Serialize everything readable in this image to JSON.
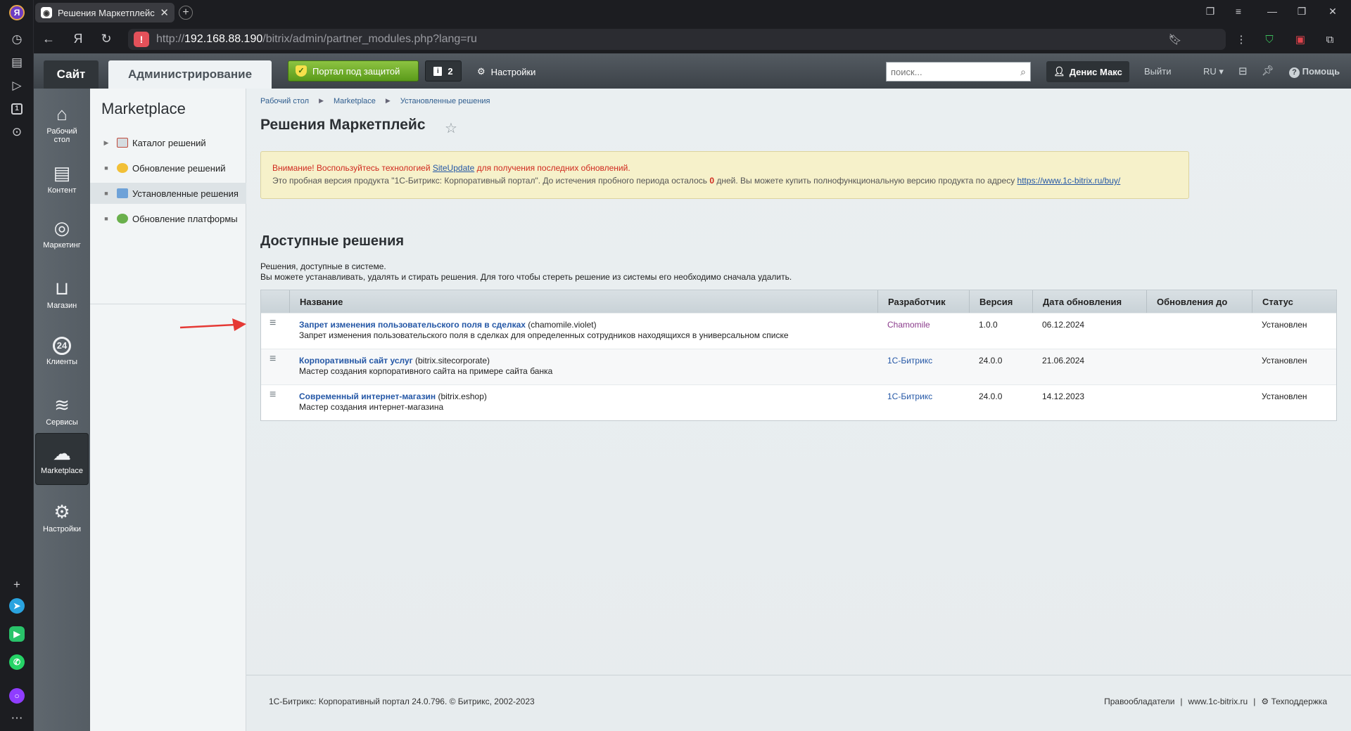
{
  "browser": {
    "tab_title": "Решения Маркетплейс",
    "tab_close": "✕",
    "new_tab": "+",
    "url_prefix": "http://",
    "url_host": "192.168.88.190",
    "url_path": "/bitrix/admin/partner_modules.php?lang=ru",
    "rail_badge": "1"
  },
  "topbar": {
    "site_tab": "Сайт",
    "admin_tab": "Администрирование",
    "protect_button": "Портал под защитой",
    "notif_count": "2",
    "settings_label": "Настройки",
    "search_placeholder": "поиск...",
    "user_name": "Денис Макс",
    "logout": "Выйти",
    "lang": "RU",
    "help": "Помощь"
  },
  "leftnav": [
    {
      "label": "Рабочий стол",
      "icon": "home-icon"
    },
    {
      "label": "Контент",
      "icon": "document-icon"
    },
    {
      "label": "Маркетинг",
      "icon": "target-icon"
    },
    {
      "label": "Магазин",
      "icon": "basket-icon"
    },
    {
      "label": "Клиенты",
      "icon": "clients-24-icon"
    },
    {
      "label": "Сервисы",
      "icon": "layers-icon"
    },
    {
      "label": "Marketplace",
      "icon": "cloud-download-icon"
    },
    {
      "label": "Настройки",
      "icon": "gear-icon"
    }
  ],
  "submenu": {
    "title": "Marketplace",
    "items": [
      {
        "label": "Каталог решений"
      },
      {
        "label": "Обновление решений"
      },
      {
        "label": "Установленные решения"
      },
      {
        "label": "Обновление платформы"
      }
    ]
  },
  "breadcrumbs": [
    "Рабочий стол",
    "Marketplace",
    "Установленные решения"
  ],
  "page_title": "Решения Маркетплейс",
  "notice": {
    "line1_a": "Внимание! Воспользуйтесь технологией ",
    "line1_link": "SiteUpdate",
    "line1_b": " для получения последних обновлений.",
    "line2_a": "Это пробная версия продукта \"1С-Битрикс: Корпоративный портал\". До истечения пробного периода осталось ",
    "line2_days": "0",
    "line2_b": " дней. Вы можете купить полнофункциональную версию продукта по адресу ",
    "line2_link": "https://www.1c-bitrix.ru/buy/"
  },
  "section_title": "Доступные решения",
  "section_desc1": "Решения, доступные в системе.",
  "section_desc2": "Вы можете устанавливать, удалять и стирать решения. Для того чтобы стереть решение из системы его необходимо сначала удалить.",
  "grid": {
    "headers": [
      "Название",
      "Разработчик",
      "Версия",
      "Дата обновления",
      "Обновления до",
      "Статус"
    ],
    "rows": [
      {
        "name": "Запрет изменения пользовательского поля в сделках",
        "code": " (chamomile.violet)",
        "desc": "Запрет изменения пользовательского поля в сделках для определенных сотрудников находящихся в универсальном списке",
        "dev": "Chamomile",
        "version": "1.0.0",
        "date": "06.12.2024",
        "until": "",
        "status": "Установлен"
      },
      {
        "name": "Корпоративный сайт услуг",
        "code": " (bitrix.sitecorporate)",
        "desc": "Мастер создания корпоративного сайта на примере сайта банка",
        "dev": "1С-Битрикс",
        "version": "24.0.0",
        "date": "21.06.2024",
        "until": "",
        "status": "Установлен"
      },
      {
        "name": "Современный интернет-магазин",
        "code": " (bitrix.eshop)",
        "desc": "Мастер создания интернет-магазина",
        "dev": "1С-Битрикс",
        "version": "24.0.0",
        "date": "14.12.2023",
        "until": "",
        "status": "Установлен"
      }
    ]
  },
  "footer": {
    "copyright": "1С-Битрикс: Корпоративный портал 24.0.796. © Битрикс, 2002-2023",
    "rights": "Правообладатели",
    "sep": "|",
    "site": "www.1c-bitrix.ru",
    "support": "Техподдержка"
  },
  "colors": {
    "accent_green": "#6aa82a",
    "notice_bg": "#f6f1ca",
    "link": "#2457a6",
    "arrow": "#e53935"
  }
}
